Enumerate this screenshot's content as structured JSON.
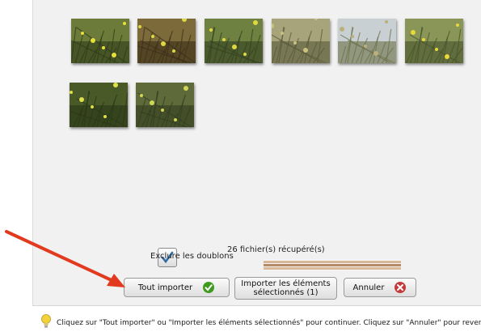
{
  "thumbnails": [
    {
      "name": "photo-1",
      "sky": "#6d7b3a",
      "ground": "#2e3a18",
      "flower": "#e7e03a"
    },
    {
      "name": "photo-2",
      "sky": "#7c6a3a",
      "ground": "#3a2f18",
      "flower": "#dfd840"
    },
    {
      "name": "photo-3",
      "sky": "#6e8140",
      "ground": "#334121",
      "flower": "#e0d83e"
    },
    {
      "name": "photo-4",
      "sky": "#a7a37a",
      "ground": "#595a3a",
      "flower": "#c9c27e"
    },
    {
      "name": "photo-5",
      "sky": "#c9d0d3",
      "ground": "#6c7048",
      "flower": "#b9b07a"
    },
    {
      "name": "photo-6",
      "sky": "#8a9658",
      "ground": "#46522a",
      "flower": "#e8d83a"
    },
    {
      "name": "photo-7",
      "sky": "#495a28",
      "ground": "#2a3618",
      "flower": "#dfe04a"
    },
    {
      "name": "photo-8",
      "sky": "#5e6a3a",
      "ground": "#333d20",
      "flower": "#cfd654"
    }
  ],
  "exclude_duplicates": {
    "label": "Exclure les doublons",
    "checked": true
  },
  "files_found": "26 fichier(s) récupéré(s)",
  "progress": 1.0,
  "buttons": {
    "import_all": "Tout importer",
    "import_selected_line1": "Importer les éléments",
    "import_selected_line2": "sélectionnés (1)",
    "cancel": "Annuler"
  },
  "hint": "Cliquez sur \"Tout importer\" ou \"Importer les éléments sélectionnés\" pour continuer. Cliquez sur \"Annuler\" pour revenir.",
  "colors": {
    "arrow": "#e23a1e",
    "check_green": "#3f9a1f",
    "cancel_red": "#c43b3b",
    "bulb": "#f2d23a"
  }
}
